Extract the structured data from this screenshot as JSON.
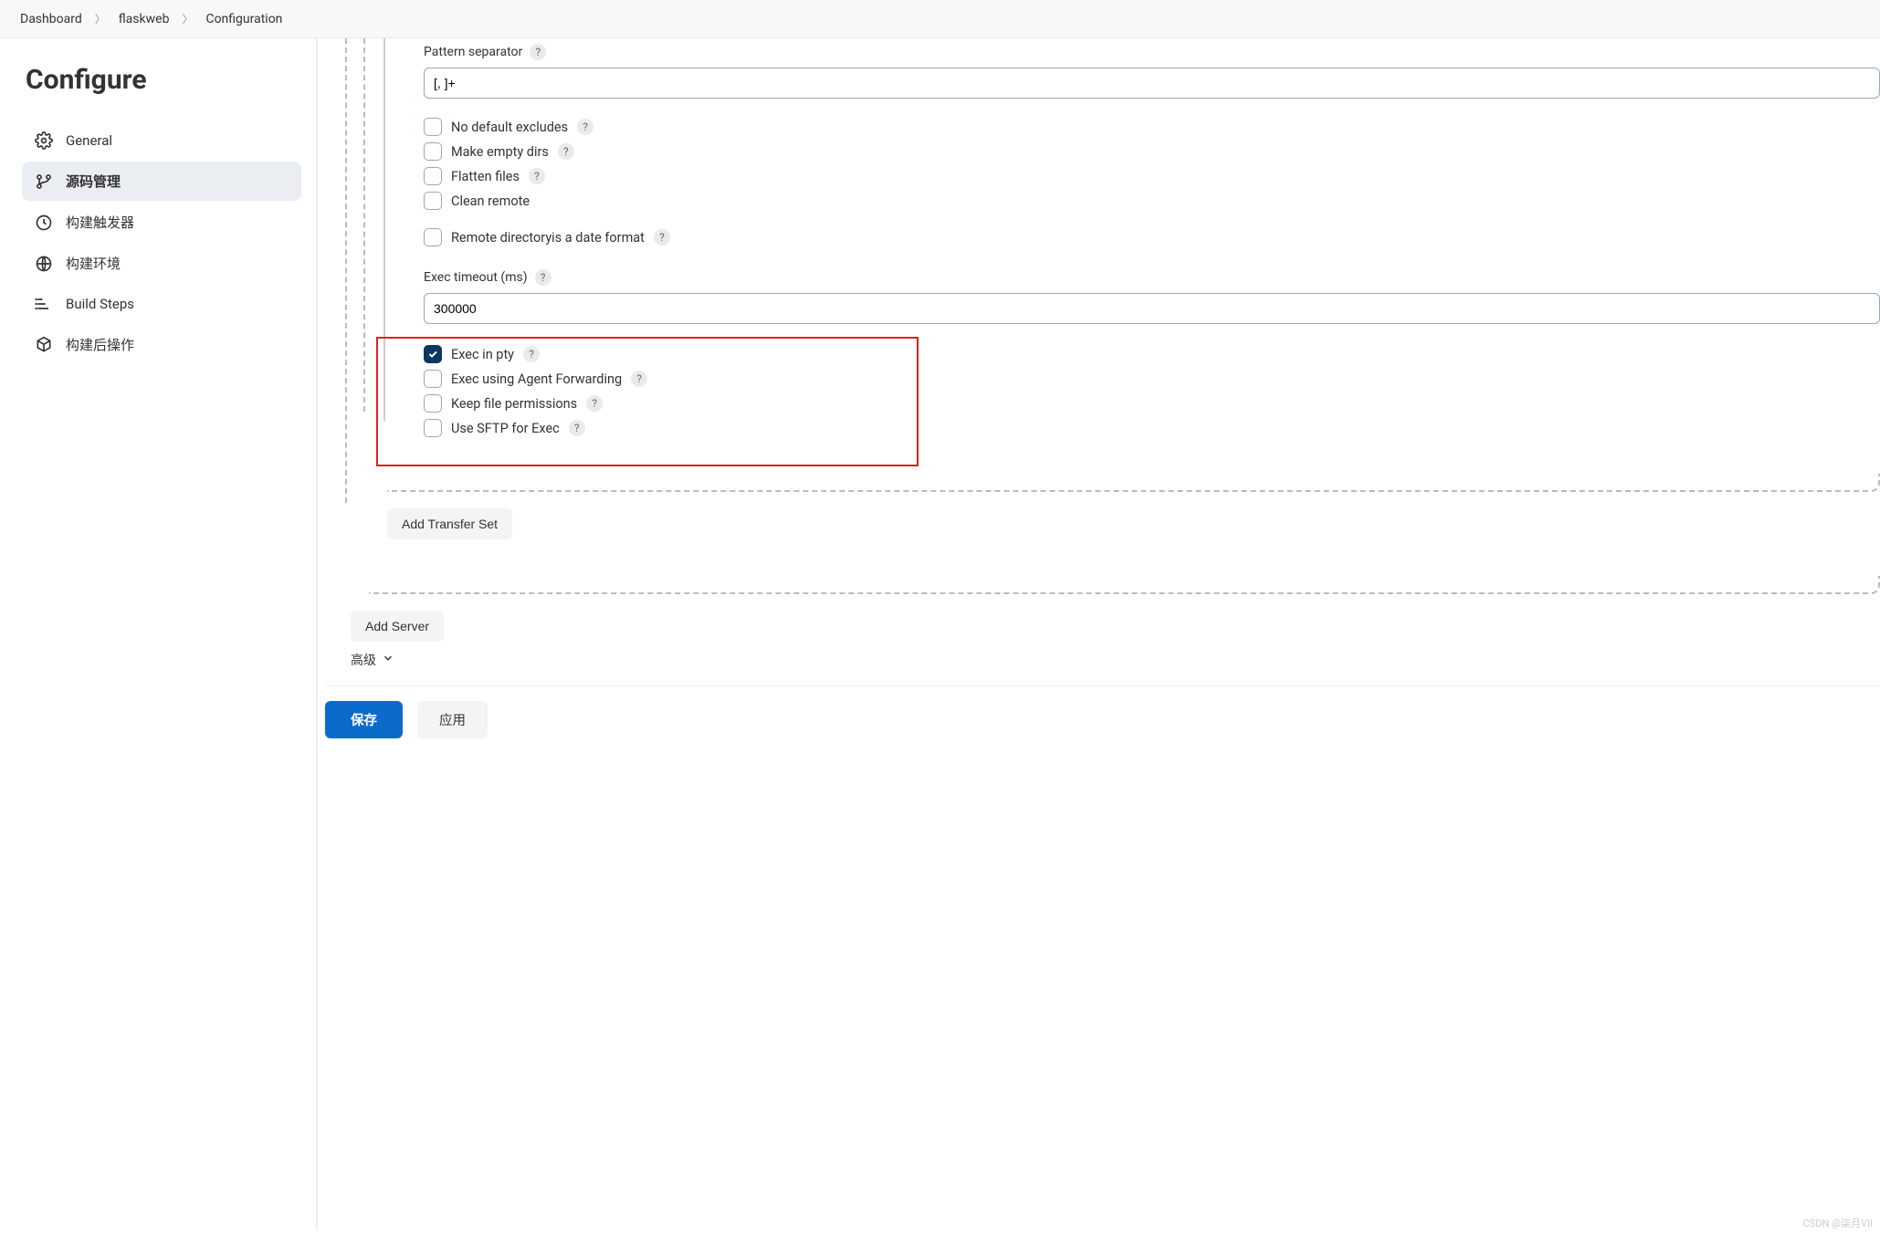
{
  "breadcrumb": {
    "dashboard": "Dashboard",
    "project": "flaskweb",
    "page": "Configuration"
  },
  "sidebar": {
    "title": "Configure",
    "items": [
      {
        "label": "General"
      },
      {
        "label": "源码管理"
      },
      {
        "label": "构建触发器"
      },
      {
        "label": "构建环境"
      },
      {
        "label": "Build Steps"
      },
      {
        "label": "构建后操作"
      }
    ]
  },
  "form": {
    "pattern_separator": {
      "label": "Pattern separator",
      "value": "[, ]+"
    },
    "no_default_excludes": "No default excludes",
    "make_empty_dirs": "Make empty dirs",
    "flatten_files": "Flatten files",
    "clean_remote": "Clean remote",
    "remote_dir_date": "Remote directoryis a date format",
    "exec_timeout": {
      "label": "Exec timeout (ms)",
      "value": "300000"
    },
    "exec_in_pty": "Exec in pty",
    "exec_agent_fwd": "Exec using Agent Forwarding",
    "keep_file_perm": "Keep file permissions",
    "use_sftp_exec": "Use SFTP for Exec",
    "add_transfer_set": "Add Transfer Set",
    "add_server": "Add Server",
    "advanced": "高级"
  },
  "footer": {
    "save": "保存",
    "apply": "应用"
  },
  "watermark": "CSDN @柒月VII"
}
